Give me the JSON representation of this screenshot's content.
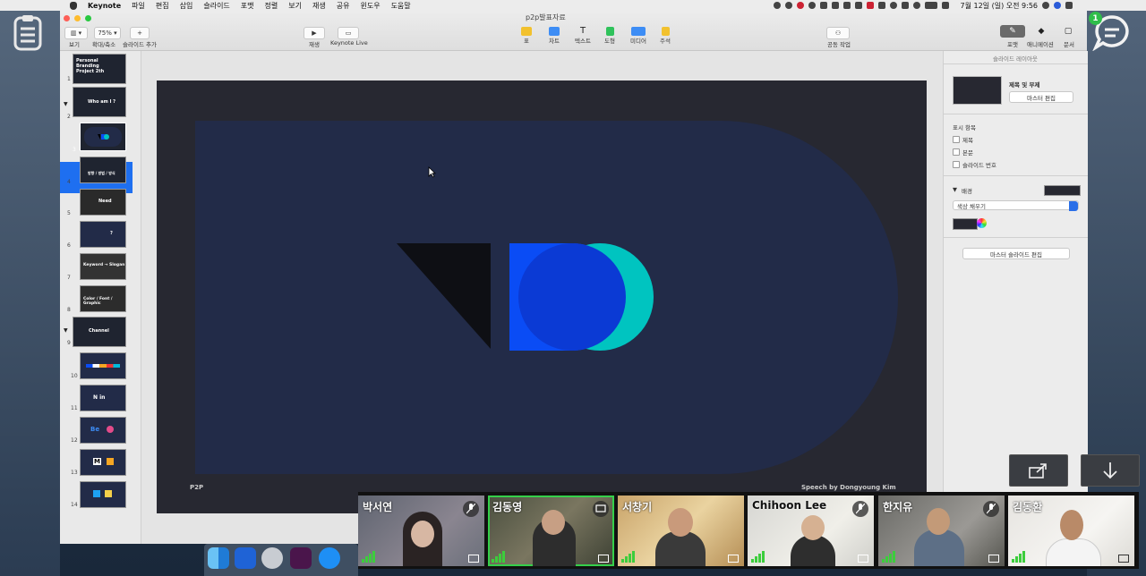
{
  "menubar": {
    "app_name": "Keynote",
    "items": [
      "파일",
      "편집",
      "삽입",
      "슬라이드",
      "포맷",
      "정렬",
      "보기",
      "재생",
      "공유",
      "윈도우",
      "도움말"
    ],
    "clock": "7월 12일 (일) 오전 9:56"
  },
  "window": {
    "title": "p2p발표자료",
    "toolbar_left": [
      {
        "label": "보기",
        "icon": "sidebar-view-icon"
      },
      {
        "label": "확대/축소",
        "value": "75%"
      },
      {
        "label": "슬라이드 추가",
        "icon": "plus-icon"
      }
    ],
    "toolbar_center": [
      {
        "label": "재생",
        "icon": "play-icon"
      },
      {
        "label": "Keynote Live",
        "icon": "keynote-live-icon"
      }
    ],
    "toolbar_insert": [
      {
        "label": "표",
        "icon": "table-icon",
        "color": "#f2c12e"
      },
      {
        "label": "차트",
        "icon": "chart-icon",
        "color": "#3d8df5"
      },
      {
        "label": "텍스트",
        "icon": "text-icon",
        "color": "#444444"
      },
      {
        "label": "도형",
        "icon": "shape-icon",
        "color": "#2fc25b"
      },
      {
        "label": "미디어",
        "icon": "media-icon",
        "color": "#3d8df5"
      },
      {
        "label": "주석",
        "icon": "comment-icon",
        "color": "#f2c12e"
      }
    ],
    "toolbar_share": {
      "label": "공동 작업",
      "icon": "collaborate-icon"
    },
    "toolbar_right": [
      {
        "label": "포맷",
        "icon": "format-brush-icon"
      },
      {
        "label": "애니메이션",
        "icon": "animate-diamond-icon"
      },
      {
        "label": "문서",
        "icon": "document-icon"
      }
    ]
  },
  "slides": [
    {
      "num": "1",
      "text": "Personal Branding Project 2th"
    },
    {
      "num": "2",
      "text": "Who am I ?"
    },
    {
      "num": "3",
      "text": ""
    },
    {
      "num": "4",
      "text": "방향 / 방법 / 방식"
    },
    {
      "num": "5",
      "text": "Need"
    },
    {
      "num": "6",
      "text": "?"
    },
    {
      "num": "7",
      "text": "Keyword → Slogan"
    },
    {
      "num": "8",
      "text": "Color / Font / Graphic"
    },
    {
      "num": "9",
      "text": "Channel"
    },
    {
      "num": "10",
      "text": ""
    },
    {
      "num": "11",
      "text": "N in"
    },
    {
      "num": "12",
      "text": "Be"
    },
    {
      "num": "13",
      "text": "M"
    },
    {
      "num": "14",
      "text": ""
    }
  ],
  "slide_canvas": {
    "left_text": "P2P",
    "right_text": "Speech by Dongyoung Kim",
    "colors": {
      "bg": "#272831",
      "panel": "#222b48",
      "blue": "#0a4cf5",
      "teal": "#00c4c0",
      "overlap": "#0b3ad4",
      "black": "#0e0f14"
    }
  },
  "inspector": {
    "header": "슬라이드 레이아웃",
    "layout_name": "제목 및 부제",
    "edit_master": "마스터 편집",
    "show_section": "표시 항목",
    "checkboxes": [
      "제목",
      "본문",
      "슬라이드 번호"
    ],
    "background_label": "배경",
    "fill_type": "색상 채우기",
    "master_edit_button": "마스터 슬라이드 편집"
  },
  "participants": [
    {
      "name": "박서연",
      "muted": true,
      "active": false
    },
    {
      "name": "김동영",
      "muted": false,
      "active": true
    },
    {
      "name": "서창기",
      "muted": false,
      "active": false
    },
    {
      "name": "Chihoon Lee",
      "muted": true,
      "active": false
    },
    {
      "name": "한지유",
      "muted": true,
      "active": false
    },
    {
      "name": "김동환",
      "muted": false,
      "active": false
    }
  ],
  "notification_badge": "1"
}
